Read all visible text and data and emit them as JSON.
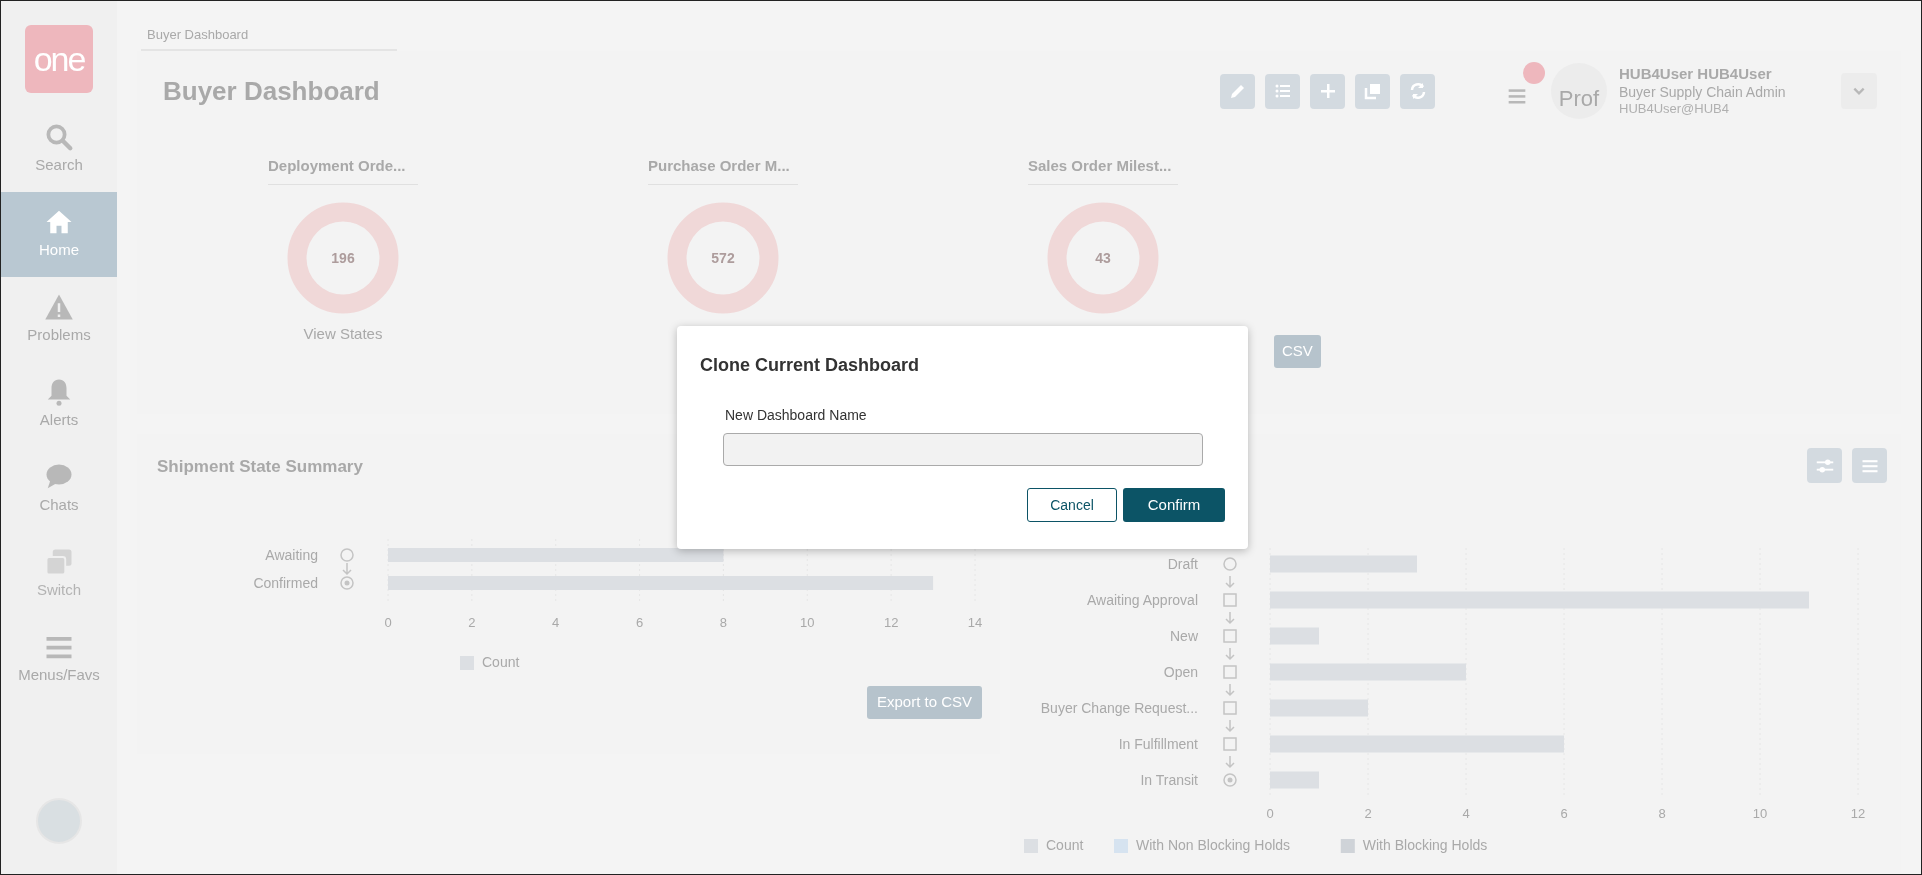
{
  "sidebar": {
    "logo": "one",
    "items": [
      {
        "kind": "search",
        "label": "Search",
        "selected": false,
        "disabled": false
      },
      {
        "kind": "home",
        "label": "Home",
        "selected": true,
        "disabled": false
      },
      {
        "kind": "warning",
        "label": "Problems",
        "selected": false,
        "disabled": false
      },
      {
        "kind": "bell",
        "label": "Alerts",
        "selected": false,
        "disabled": false
      },
      {
        "kind": "chat",
        "label": "Chats",
        "selected": false,
        "disabled": false
      },
      {
        "kind": "switch",
        "label": "Switch",
        "selected": false,
        "disabled": true
      },
      {
        "kind": "menu",
        "label": "Menus/Favs",
        "selected": false,
        "disabled": false
      }
    ]
  },
  "breadcrumb": "Buyer Dashboard",
  "header": {
    "title": "Buyer Dashboard",
    "user": {
      "avatar_text": "Prof",
      "name": "HUB4User HUB4User",
      "role": "Buyer Supply Chain Admin",
      "email": "HUB4User@HUB4"
    }
  },
  "donut_cards": [
    {
      "title": "Deployment Orde...",
      "value": "196",
      "link": "View States"
    },
    {
      "title": "Purchase Order M...",
      "value": "572"
    },
    {
      "title": "Sales Order Milest...",
      "value": "43",
      "button": "CSV"
    }
  ],
  "shipment_panel": {
    "title": "Shipment State Summary",
    "chart_data": {
      "type": "bar",
      "orientation": "horizontal",
      "grid": true,
      "categories": [
        "Awaiting",
        "Confirmed"
      ],
      "xlim": [
        0,
        14
      ],
      "xticks": [
        0,
        2,
        4,
        6,
        8,
        10,
        12,
        14
      ],
      "series": [
        {
          "name": "Count",
          "color": "#dcdfe3",
          "values": [
            8,
            13
          ]
        }
      ]
    },
    "button": "Export to CSV"
  },
  "order_panel": {
    "chart_data": {
      "type": "bar",
      "orientation": "horizontal",
      "grid": true,
      "categories": [
        "Draft",
        "Awaiting Approval",
        "New",
        "Open",
        "Buyer Change Request...",
        "In Fulfillment",
        "In Transit"
      ],
      "xlim": [
        0,
        12
      ],
      "xticks": [
        0,
        2,
        4,
        6,
        8,
        10,
        12
      ],
      "series": [
        {
          "name": "Count",
          "color": "#dcdfe3",
          "values": [
            3,
            11,
            1,
            4,
            2,
            6,
            1
          ]
        },
        {
          "name": "With Non Blocking Holds",
          "color": "#d6e3f0",
          "values": [
            0,
            0,
            0,
            0,
            0,
            0,
            0
          ]
        },
        {
          "name": "With Blocking Holds",
          "color": "#cfd3d8",
          "values": [
            0,
            0,
            0,
            0,
            0,
            0,
            0
          ]
        }
      ]
    }
  },
  "modal": {
    "title": "Clone Current Dashboard",
    "field_label": "New Dashboard Name",
    "buttons": [
      {
        "kind": "secondary",
        "label": "Cancel"
      },
      {
        "kind": "primary",
        "label": "Confirm"
      }
    ]
  }
}
